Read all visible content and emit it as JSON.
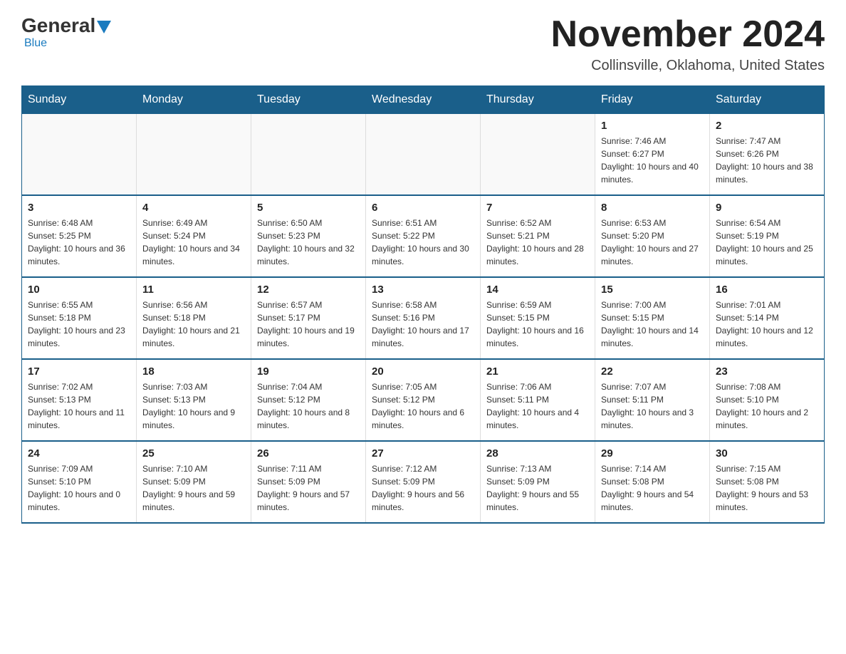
{
  "logo": {
    "general": "General",
    "blue": "Blue"
  },
  "title": "November 2024",
  "location": "Collinsville, Oklahoma, United States",
  "days_of_week": [
    "Sunday",
    "Monday",
    "Tuesday",
    "Wednesday",
    "Thursday",
    "Friday",
    "Saturday"
  ],
  "weeks": [
    [
      {
        "day": "",
        "info": ""
      },
      {
        "day": "",
        "info": ""
      },
      {
        "day": "",
        "info": ""
      },
      {
        "day": "",
        "info": ""
      },
      {
        "day": "",
        "info": ""
      },
      {
        "day": "1",
        "info": "Sunrise: 7:46 AM\nSunset: 6:27 PM\nDaylight: 10 hours and 40 minutes."
      },
      {
        "day": "2",
        "info": "Sunrise: 7:47 AM\nSunset: 6:26 PM\nDaylight: 10 hours and 38 minutes."
      }
    ],
    [
      {
        "day": "3",
        "info": "Sunrise: 6:48 AM\nSunset: 5:25 PM\nDaylight: 10 hours and 36 minutes."
      },
      {
        "day": "4",
        "info": "Sunrise: 6:49 AM\nSunset: 5:24 PM\nDaylight: 10 hours and 34 minutes."
      },
      {
        "day": "5",
        "info": "Sunrise: 6:50 AM\nSunset: 5:23 PM\nDaylight: 10 hours and 32 minutes."
      },
      {
        "day": "6",
        "info": "Sunrise: 6:51 AM\nSunset: 5:22 PM\nDaylight: 10 hours and 30 minutes."
      },
      {
        "day": "7",
        "info": "Sunrise: 6:52 AM\nSunset: 5:21 PM\nDaylight: 10 hours and 28 minutes."
      },
      {
        "day": "8",
        "info": "Sunrise: 6:53 AM\nSunset: 5:20 PM\nDaylight: 10 hours and 27 minutes."
      },
      {
        "day": "9",
        "info": "Sunrise: 6:54 AM\nSunset: 5:19 PM\nDaylight: 10 hours and 25 minutes."
      }
    ],
    [
      {
        "day": "10",
        "info": "Sunrise: 6:55 AM\nSunset: 5:18 PM\nDaylight: 10 hours and 23 minutes."
      },
      {
        "day": "11",
        "info": "Sunrise: 6:56 AM\nSunset: 5:18 PM\nDaylight: 10 hours and 21 minutes."
      },
      {
        "day": "12",
        "info": "Sunrise: 6:57 AM\nSunset: 5:17 PM\nDaylight: 10 hours and 19 minutes."
      },
      {
        "day": "13",
        "info": "Sunrise: 6:58 AM\nSunset: 5:16 PM\nDaylight: 10 hours and 17 minutes."
      },
      {
        "day": "14",
        "info": "Sunrise: 6:59 AM\nSunset: 5:15 PM\nDaylight: 10 hours and 16 minutes."
      },
      {
        "day": "15",
        "info": "Sunrise: 7:00 AM\nSunset: 5:15 PM\nDaylight: 10 hours and 14 minutes."
      },
      {
        "day": "16",
        "info": "Sunrise: 7:01 AM\nSunset: 5:14 PM\nDaylight: 10 hours and 12 minutes."
      }
    ],
    [
      {
        "day": "17",
        "info": "Sunrise: 7:02 AM\nSunset: 5:13 PM\nDaylight: 10 hours and 11 minutes."
      },
      {
        "day": "18",
        "info": "Sunrise: 7:03 AM\nSunset: 5:13 PM\nDaylight: 10 hours and 9 minutes."
      },
      {
        "day": "19",
        "info": "Sunrise: 7:04 AM\nSunset: 5:12 PM\nDaylight: 10 hours and 8 minutes."
      },
      {
        "day": "20",
        "info": "Sunrise: 7:05 AM\nSunset: 5:12 PM\nDaylight: 10 hours and 6 minutes."
      },
      {
        "day": "21",
        "info": "Sunrise: 7:06 AM\nSunset: 5:11 PM\nDaylight: 10 hours and 4 minutes."
      },
      {
        "day": "22",
        "info": "Sunrise: 7:07 AM\nSunset: 5:11 PM\nDaylight: 10 hours and 3 minutes."
      },
      {
        "day": "23",
        "info": "Sunrise: 7:08 AM\nSunset: 5:10 PM\nDaylight: 10 hours and 2 minutes."
      }
    ],
    [
      {
        "day": "24",
        "info": "Sunrise: 7:09 AM\nSunset: 5:10 PM\nDaylight: 10 hours and 0 minutes."
      },
      {
        "day": "25",
        "info": "Sunrise: 7:10 AM\nSunset: 5:09 PM\nDaylight: 9 hours and 59 minutes."
      },
      {
        "day": "26",
        "info": "Sunrise: 7:11 AM\nSunset: 5:09 PM\nDaylight: 9 hours and 57 minutes."
      },
      {
        "day": "27",
        "info": "Sunrise: 7:12 AM\nSunset: 5:09 PM\nDaylight: 9 hours and 56 minutes."
      },
      {
        "day": "28",
        "info": "Sunrise: 7:13 AM\nSunset: 5:09 PM\nDaylight: 9 hours and 55 minutes."
      },
      {
        "day": "29",
        "info": "Sunrise: 7:14 AM\nSunset: 5:08 PM\nDaylight: 9 hours and 54 minutes."
      },
      {
        "day": "30",
        "info": "Sunrise: 7:15 AM\nSunset: 5:08 PM\nDaylight: 9 hours and 53 minutes."
      }
    ]
  ]
}
